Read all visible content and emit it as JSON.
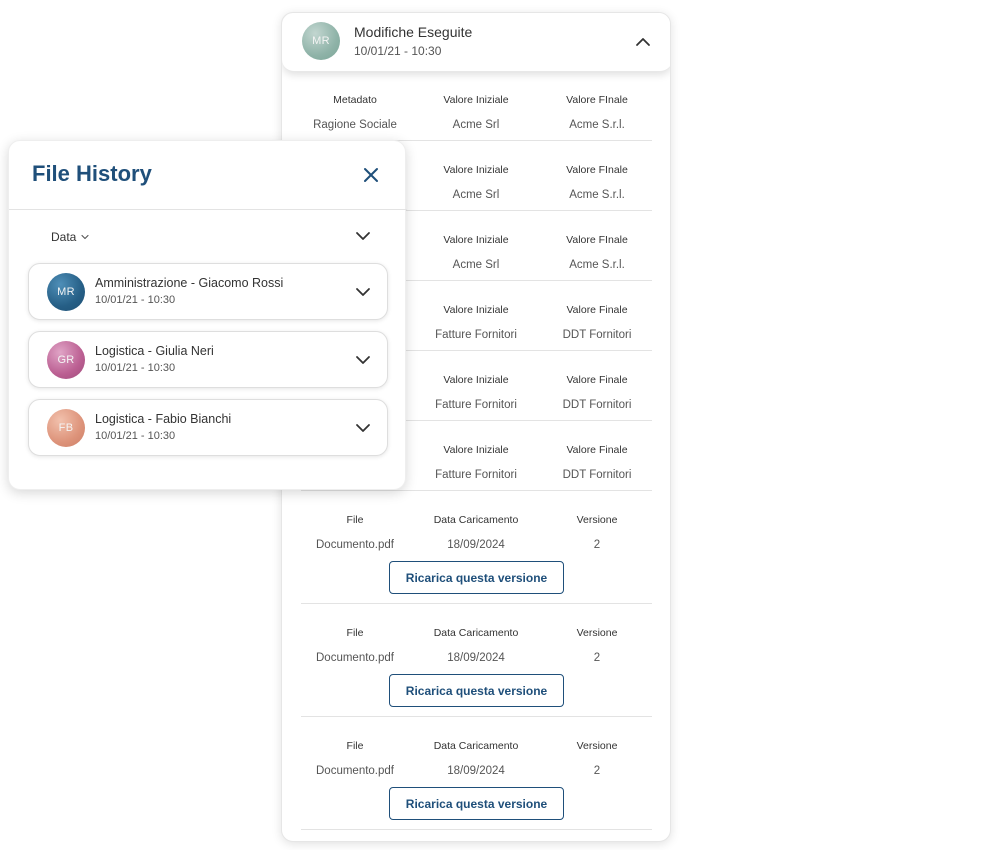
{
  "change_panel": {
    "avatar_initials": "MR",
    "title": "Modifiche Eseguite",
    "timestamp": "10/01/21 - 10:30",
    "collapse_icon": "chevron-up-icon",
    "metadata_rows": [
      {
        "headers": [
          "Metadato",
          "Valore Iniziale",
          "Valore FInale"
        ],
        "values": [
          "Ragione Sociale",
          "Acme Srl",
          "Acme S.r.l."
        ]
      },
      {
        "headers": [
          "",
          "Valore Iniziale",
          "Valore FInale"
        ],
        "values": [
          "",
          "Acme Srl",
          "Acme S.r.l."
        ]
      },
      {
        "headers": [
          "",
          "Valore Iniziale",
          "Valore FInale"
        ],
        "values": [
          "",
          "Acme Srl",
          "Acme S.r.l."
        ]
      },
      {
        "headers": [
          "",
          "Valore Iniziale",
          "Valore Finale"
        ],
        "values": [
          "",
          "Fatture Fornitori",
          "DDT Fornitori"
        ]
      },
      {
        "headers": [
          "",
          "Valore Iniziale",
          "Valore Finale"
        ],
        "values": [
          "",
          "Fatture Fornitori",
          "DDT Fornitori"
        ]
      },
      {
        "headers": [
          "",
          "Valore Iniziale",
          "Valore Finale"
        ],
        "values": [
          "",
          "Fatture Fornitori",
          "DDT Fornitori"
        ]
      }
    ],
    "file_rows": [
      {
        "headers": [
          "File",
          "Data Caricamento",
          "Versione"
        ],
        "values": [
          "Documento.pdf",
          "18/09/2024",
          "2"
        ],
        "button": "Ricarica questa versione"
      },
      {
        "headers": [
          "File",
          "Data Caricamento",
          "Versione"
        ],
        "values": [
          "Documento.pdf",
          "18/09/2024",
          "2"
        ],
        "button": "Ricarica questa versione"
      },
      {
        "headers": [
          "File",
          "Data Caricamento",
          "Versione"
        ],
        "values": [
          "Documento.pdf",
          "18/09/2024",
          "2"
        ],
        "button": "Ricarica questa versione"
      }
    ]
  },
  "history_panel": {
    "title": "File History",
    "close_icon": "close-icon",
    "filter_label": "Data",
    "filter_icon": "chevron-down-icon",
    "entries": [
      {
        "initials": "MR",
        "name": "Amministrazione - Giacomo Rossi",
        "timestamp": "10/01/21 - 10:30"
      },
      {
        "initials": "GR",
        "name": "Logistica - Giulia Neri",
        "timestamp": "10/01/21 - 10:30"
      },
      {
        "initials": "FB",
        "name": "Logistica - Fabio Bianchi",
        "timestamp": "10/01/21 - 10:30"
      }
    ]
  },
  "colors": {
    "brand_blue": "#1f4f7a",
    "divider": "#e3e3e3"
  }
}
